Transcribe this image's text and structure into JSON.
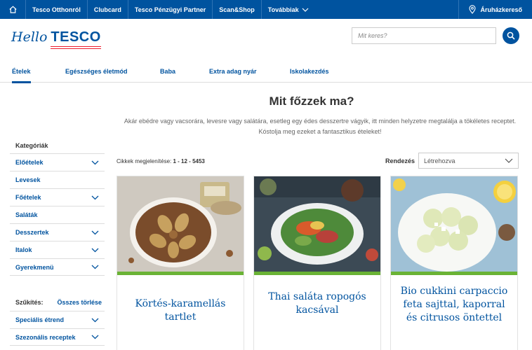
{
  "topbar": {
    "items": [
      "Tesco Otthonról",
      "Clubcard",
      "Tesco Pénzügyi Partner",
      "Scan&Shop",
      "Továbbiak"
    ],
    "store_finder": "Áruházkereső"
  },
  "logo": {
    "hello": "Hello",
    "brand": "TESCO"
  },
  "search": {
    "placeholder": "Mit keres?"
  },
  "nav": {
    "tabs": [
      "Ételek",
      "Egészséges életmód",
      "Baba",
      "Extra adag nyár",
      "Iskolakezdés"
    ]
  },
  "page": {
    "title": "Mit főzzek ma?",
    "intro": "Akár ebédre vagy vacsorára, levesre vagy salátára, esetleg egy édes desszertre vágyik, itt minden helyzetre megtalálja a tökéletes receptet. Kóstolja meg ezeket a fantasztikus ételeket!"
  },
  "sidebar": {
    "heading": "Kategóriák",
    "items": [
      {
        "label": "Előételek",
        "expandable": true
      },
      {
        "label": "Levesek",
        "expandable": false
      },
      {
        "label": "Főételek",
        "expandable": true
      },
      {
        "label": "Saláták",
        "expandable": false
      },
      {
        "label": "Desszertek",
        "expandable": true
      },
      {
        "label": "Italok",
        "expandable": true
      },
      {
        "label": "Gyerekmenü",
        "expandable": true
      }
    ],
    "filter_label": "Szűkítés:",
    "clear_all": "Összes törlése",
    "filters": [
      "Speciális étrend",
      "Szezonális receptek"
    ]
  },
  "results": {
    "count_label": "Cikkek megjelenítése:",
    "count_value": "1 - 12 - 5453",
    "sort_label": "Rendezés",
    "sort_value": "Létrehozva"
  },
  "recipes": [
    {
      "title": "Körtés-karamellás tartlet"
    },
    {
      "title": "Thai saláta ropogós kacsával"
    },
    {
      "title": "Bio cukkini carpaccio feta sajttal, kaporral és citrusos öntettel"
    }
  ],
  "colors": {
    "brand_blue": "#00539f",
    "accent_red": "#ee1c2e",
    "card_green": "#6ab335"
  }
}
